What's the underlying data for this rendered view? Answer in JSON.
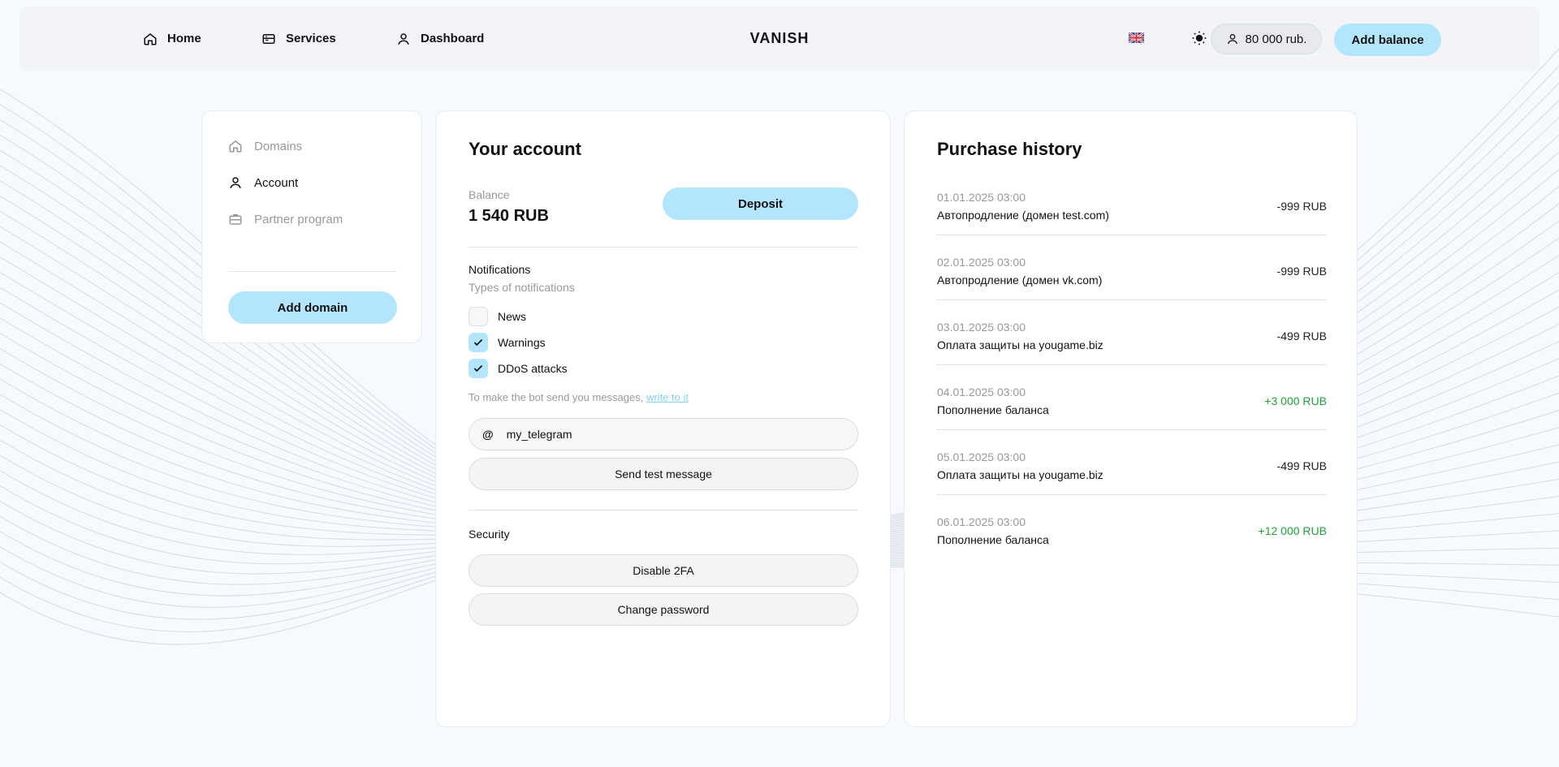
{
  "nav": {
    "home": "Home",
    "services": "Services",
    "dashboard": "Dashboard",
    "brand": "VANISH",
    "wallet": "80 000 rub.",
    "add_balance": "Add balance"
  },
  "sidebar": {
    "items": [
      {
        "label": "Domains",
        "icon": "home-icon"
      },
      {
        "label": "Account",
        "icon": "user-icon"
      },
      {
        "label": "Partner program",
        "icon": "briefcase-icon"
      }
    ],
    "add_domain": "Add domain"
  },
  "account": {
    "title": "Your account",
    "balance_label": "Balance",
    "balance_value": "1 540 RUB",
    "deposit": "Deposit",
    "notifications_label": "Notifications",
    "notifications_sub": "Types of notifications",
    "options": [
      {
        "label": "News",
        "checked": false
      },
      {
        "label": "Warnings",
        "checked": true
      },
      {
        "label": "DDoS attacks",
        "checked": true
      }
    ],
    "bot_note": "To make the bot send you messages, ",
    "bot_link": "write to it",
    "telegram_value": "my_telegram",
    "send_test": "Send test message",
    "security_label": "Security",
    "disable_2fa": "Disable 2FA",
    "change_password": "Change password"
  },
  "history": {
    "title": "Purchase history",
    "rows": [
      {
        "date": "01.01.2025 03:00",
        "desc": "Автопродление (домен test.com)",
        "amount": "-999 RUB"
      },
      {
        "date": "02.01.2025 03:00",
        "desc": "Автопродление (домен vk.com)",
        "amount": "-999 RUB"
      },
      {
        "date": "03.01.2025 03:00",
        "desc": "Оплата защиты на yougame.biz",
        "amount": "-499 RUB"
      },
      {
        "date": "04.01.2025 03:00",
        "desc": "Пополнение баланса",
        "amount": "+3 000 RUB"
      },
      {
        "date": "05.01.2025 03:00",
        "desc": "Оплата защиты на yougame.biz",
        "amount": "-499 RUB"
      },
      {
        "date": "06.01.2025 03:00",
        "desc": "Пополнение баланса",
        "amount": "+12 000 RUB"
      }
    ]
  },
  "colors": {
    "accent": "#b3e6fc",
    "positive": "#1ea335",
    "link": "#7fd3f5"
  }
}
